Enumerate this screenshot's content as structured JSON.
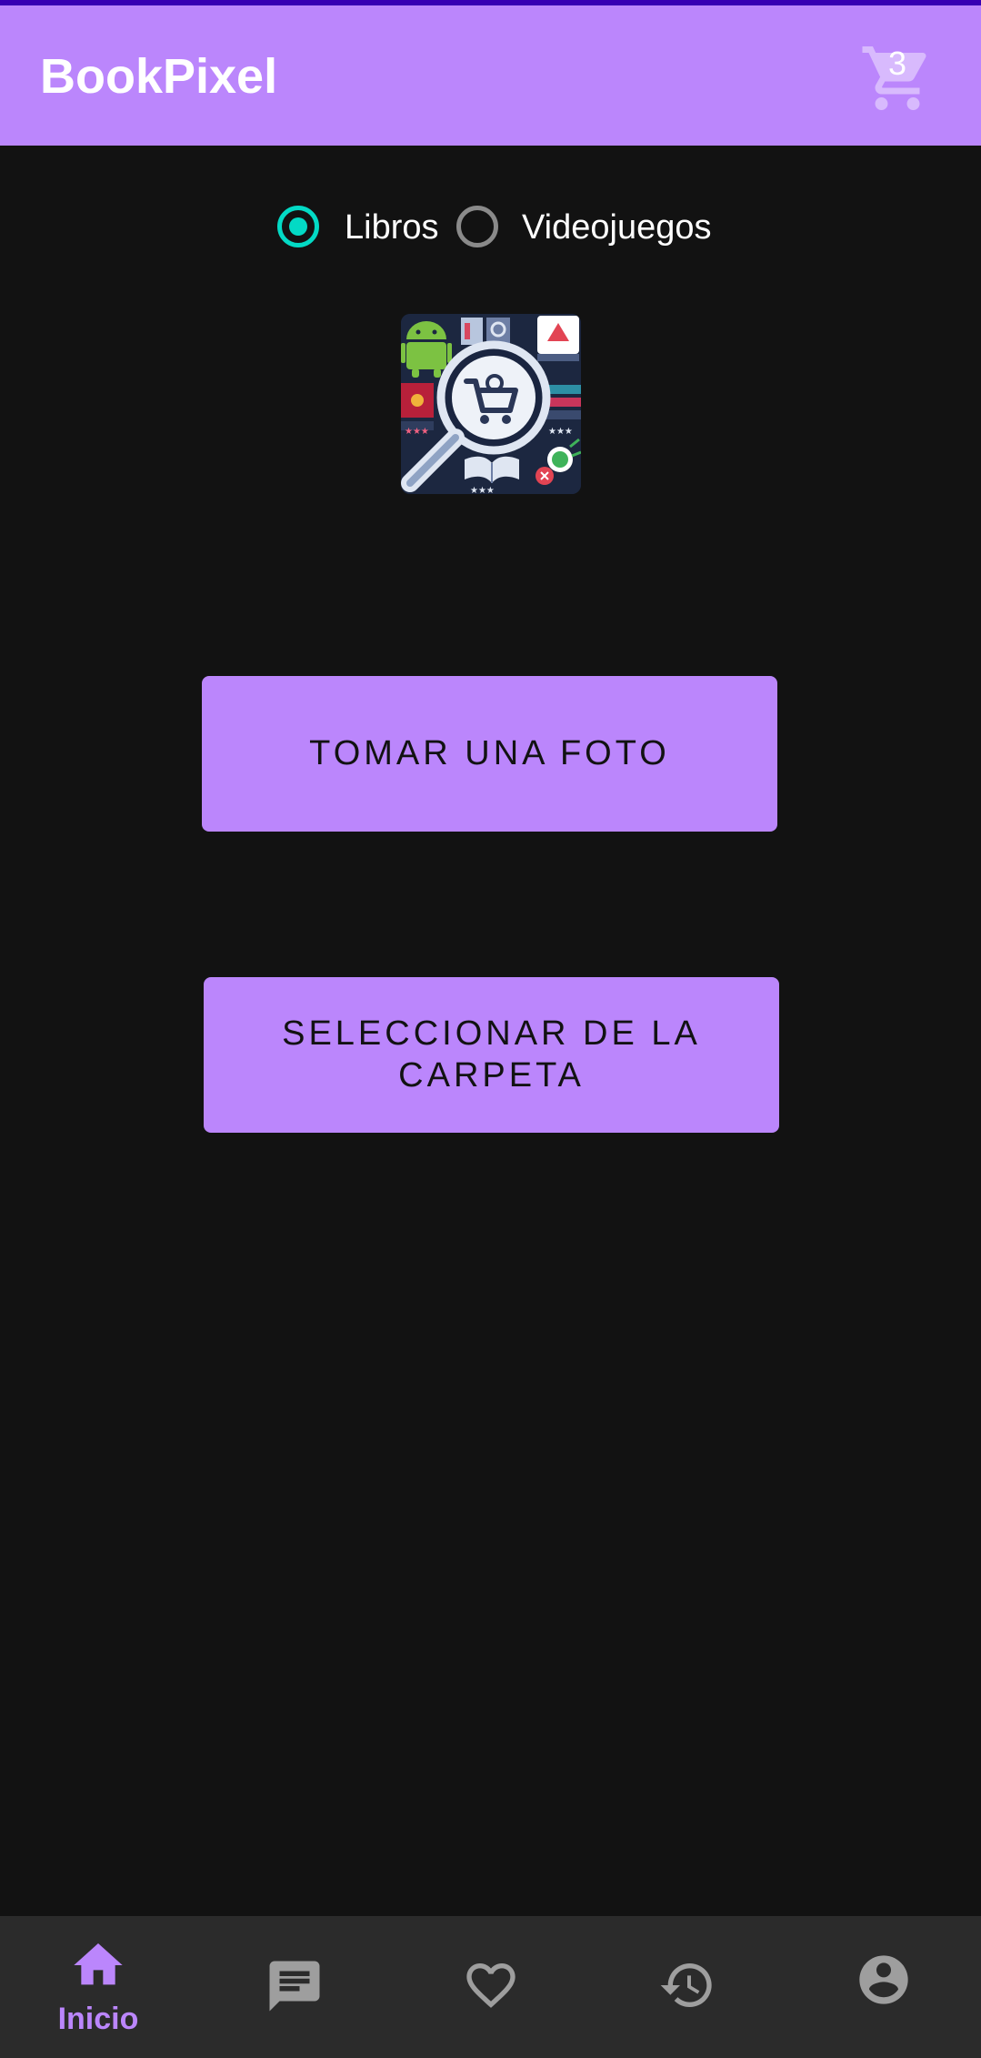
{
  "app_bar": {
    "title": "BookPixel",
    "cart_icon": "shopping-cart-icon",
    "cart_count": "3"
  },
  "category_selector": {
    "options": [
      {
        "label": "Libros",
        "selected": true
      },
      {
        "label": "Videojuegos",
        "selected": false
      }
    ]
  },
  "logo": {
    "icon": "magnifier-cart-logo"
  },
  "actions": {
    "take_photo_label": "TOMAR UNA FOTO",
    "select_folder_label": "SELECCIONAR DE LA CARPETA"
  },
  "bottom_nav": {
    "items": [
      {
        "icon": "home-icon",
        "label": "Inicio",
        "active": true
      },
      {
        "icon": "chat-icon",
        "label": "",
        "active": false
      },
      {
        "icon": "heart-icon",
        "label": "",
        "active": false
      },
      {
        "icon": "history-icon",
        "label": "",
        "active": false
      },
      {
        "icon": "account-icon",
        "label": "",
        "active": false
      }
    ]
  },
  "colors": {
    "primary": "#bb86fc",
    "primary_dark": "#3700b3",
    "accent": "#03dac5",
    "background": "#121212",
    "nav_background": "#2b2b2b",
    "inactive_icon": "#9e9e9e"
  }
}
